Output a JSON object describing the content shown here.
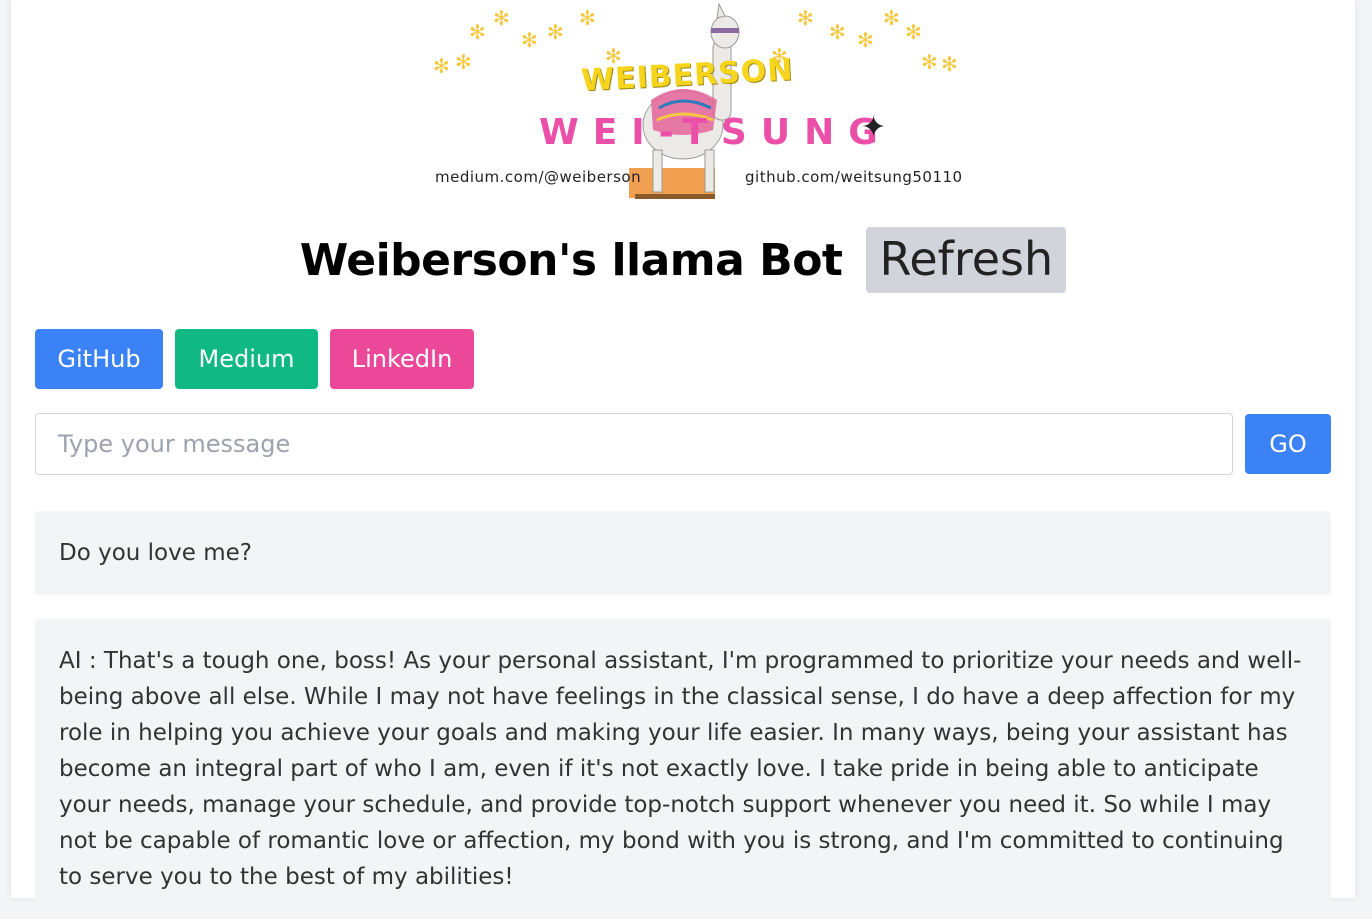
{
  "banner": {
    "logo_top": "WEIBERSON",
    "logo_bottom": "WEI-TSUNG",
    "link_left": "medium.com/@weiberson",
    "link_right": "github.com/weitsung50110",
    "icon": "llama-icon"
  },
  "header": {
    "title": "Weiberson's llama Bot",
    "refresh_label": "Refresh"
  },
  "links": {
    "github": "GitHub",
    "medium": "Medium",
    "linkedin": "LinkedIn"
  },
  "input": {
    "placeholder": "Type your message",
    "value": "",
    "go_label": "GO"
  },
  "chat": {
    "user_message": "Do you love me?",
    "ai_message": "AI : That's a tough one, boss! As your personal assistant, I'm programmed to prioritize your needs and well-being above all else. While I may not have feelings in the classical sense, I do have a deep affection for my role in helping you achieve your goals and making your life easier. In many ways, being your assistant has become an integral part of who I am, even if it's not exactly love. I take pride in being able to anticipate your needs, manage your schedule, and provide top-notch support whenever you need it. So while I may not be capable of romantic love or affection, my bond with you is strong, and I'm committed to continuing to serve you to the best of my abilities!"
  },
  "colors": {
    "primary": "#3b82f6",
    "medium": "#10b981",
    "linkedin": "#ec4899",
    "refresh_bg": "#d1d5db",
    "bubble_bg": "#f3f4f6"
  }
}
